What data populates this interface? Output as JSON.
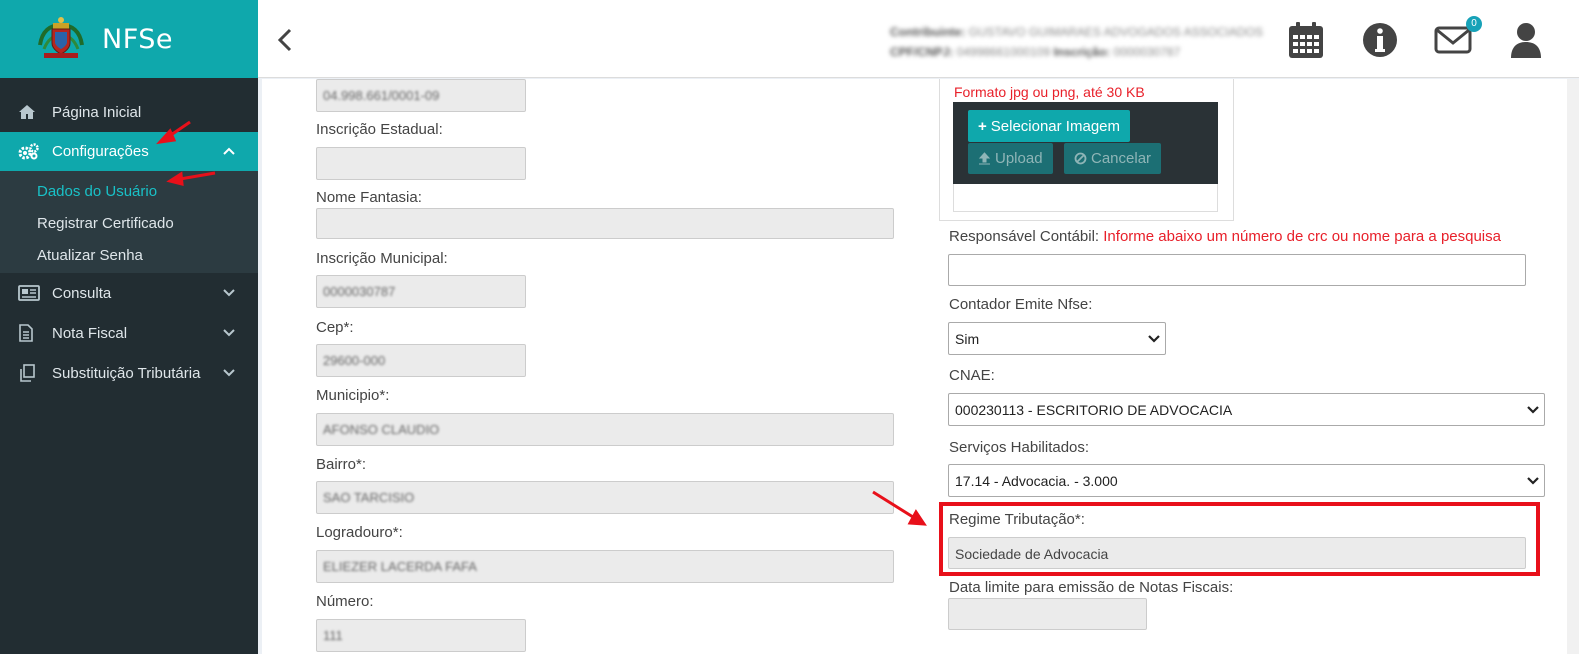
{
  "app": {
    "title": "NFSe"
  },
  "sidebar": {
    "items": [
      {
        "label": "Página Inicial",
        "icon": "home-icon"
      },
      {
        "label": "Configurações",
        "icon": "gears-icon"
      },
      {
        "label": "Consulta",
        "icon": "newspaper-icon"
      },
      {
        "label": "Nota Fiscal",
        "icon": "document-icon"
      },
      {
        "label": "Substituição Tributária",
        "icon": "copy-icon"
      }
    ],
    "submenu": [
      "Dados do Usuário",
      "Registrar Certificado",
      "Atualizar Senha"
    ]
  },
  "header": {
    "contribuinte_label": "Contribuinte:",
    "contribuinte_value": "GUSTAVO GUIMARAES ADVOGADOS ASSOCIADOS",
    "cpf_label": "CPF/CNPJ:",
    "cpf_value": "04998661000109",
    "inscricao_label": "Inscrição:",
    "inscricao_value": "0000030787",
    "notification_count": "0"
  },
  "form_left": {
    "cnpj_value": "04.998.661/0001-09",
    "inscricao_estadual_label": "Inscrição Estadual:",
    "inscricao_estadual_value": "",
    "nome_fantasia_label": "Nome Fantasia:",
    "nome_fantasia_value": "",
    "inscricao_municipal_label": "Inscrição Municipal:",
    "inscricao_municipal_value": "0000030787",
    "cep_label": "Cep*:",
    "cep_value": "29600-000",
    "municipio_label": "Municipio*:",
    "municipio_value": "AFONSO CLAUDIO",
    "bairro_label": "Bairro*:",
    "bairro_value": "SAO TARCISIO",
    "logradouro_label": "Logradouro*:",
    "logradouro_value": "ELIEZER LACERDA FAFA",
    "numero_label": "Número:",
    "numero_value": "111"
  },
  "form_right": {
    "upload_hint": "Formato jpg ou png, até 30 KB",
    "select_image_label": "Selecionar Imagem",
    "upload_label": "Upload",
    "cancel_label": "Cancelar",
    "responsavel_label": "Responsável Contábil:",
    "responsavel_hint": "Informe abaixo um número de crc ou nome para a pesquisa",
    "responsavel_value": "",
    "contador_label": "Contador Emite Nfse:",
    "contador_value": "Sim",
    "cnae_label": "CNAE:",
    "cnae_value": "000230113 - ESCRITORIO DE ADVOCACIA",
    "servicos_label": "Serviços Habilitados:",
    "servicos_value": "17.14 - Advocacia. - 3.000",
    "regime_label": "Regime Tributação*:",
    "regime_value": "Sociedade de Advocacia",
    "data_limite_label": "Data limite para emissão de Notas Fiscais:",
    "data_limite_value": ""
  },
  "colors": {
    "accent": "#0fa8ac",
    "sidebar": "#222d32",
    "highlight": "#e8101a"
  }
}
